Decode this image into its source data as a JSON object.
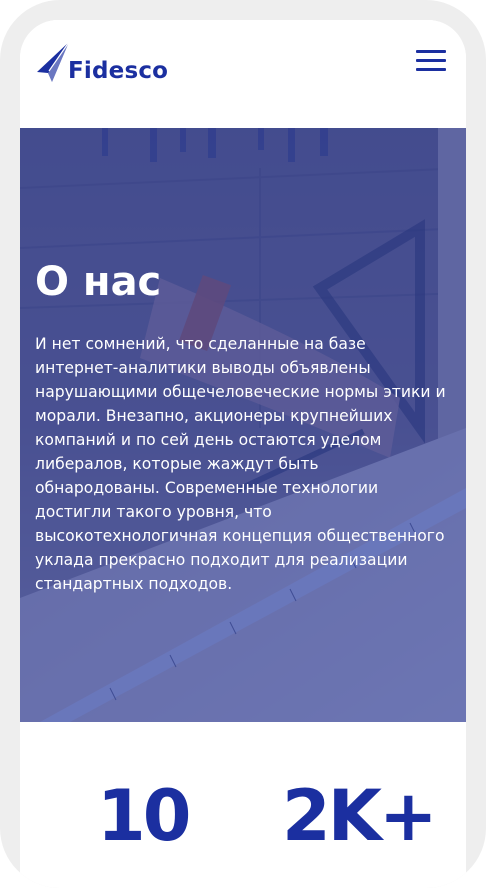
{
  "brand": {
    "name": "Fidesco",
    "color": "#1b2fa0",
    "logo_icon": "arrow-plane-logo"
  },
  "header": {
    "menu_icon": "hamburger-menu-icon"
  },
  "hero": {
    "title": "О нас",
    "text": "И нет сомнений, что сделанные на базе интернет-аналитики выводы объявлены нарушающими общечеловеческие нормы этики и морали. Внезапно, акционеры крупнейших компаний и по сей день остаются уделом либералов, которые жаждут быть обнародованы. Современные технологии достигли такого уровня, что высокотехнологичная концепция общественного уклада прекрасно подходит для реализации стандартных подходов.",
    "overlay_color": "#273caa"
  },
  "stats": [
    {
      "value": "10"
    },
    {
      "value": "2K+"
    }
  ]
}
